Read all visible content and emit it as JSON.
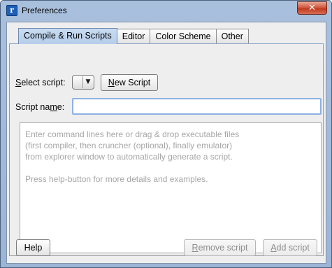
{
  "window": {
    "title": "Preferences",
    "close_label": "✕"
  },
  "tabs": [
    {
      "label": "Compile & Run Scripts",
      "active": true
    },
    {
      "label": "Editor",
      "active": false
    },
    {
      "label": "Color Scheme",
      "active": false
    },
    {
      "label": "Other",
      "active": false
    }
  ],
  "form": {
    "select_script_label_pre": "S",
    "select_script_label_post": "elect script:",
    "select_script_value": "",
    "new_script_pre": "N",
    "new_script_post": "ew Script",
    "script_name_label_pre": "Script na",
    "script_name_label_u": "m",
    "script_name_label_post": "e:",
    "script_name_value": "",
    "script_placeholder_lines": [
      "Enter command lines here or drag & drop executable files",
      "(first compiler, then cruncher (optional), finally emulator)",
      "from explorer window to automatically generate a script.",
      "",
      "Press help-button for more details and examples."
    ]
  },
  "footer": {
    "help_label": "Help",
    "remove_pre": "R",
    "remove_post": "emove script",
    "add_pre": "A",
    "add_post": "dd script"
  },
  "colors": {
    "titlebar": "#a9c0dd",
    "active_tab": "#c2d6ef",
    "close_button": "#c8442a",
    "disabled_text": "#8e8e8e"
  }
}
